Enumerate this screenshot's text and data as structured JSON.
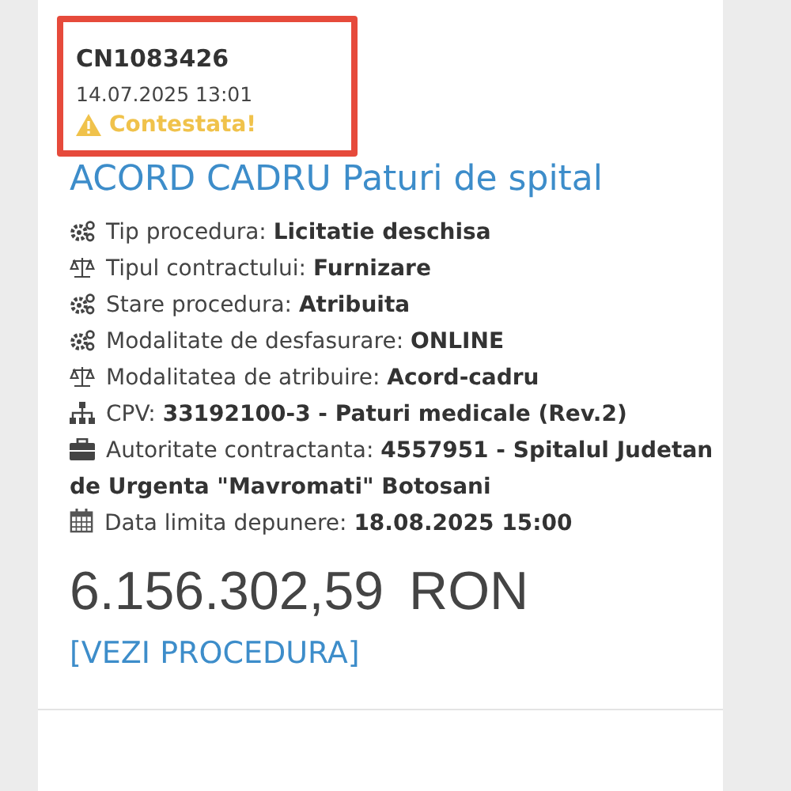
{
  "header": {
    "code": "CN1083426",
    "date": "14.07.2025 13:01",
    "status": {
      "kind": "warning",
      "text": "Contestata!"
    },
    "highlighted": true
  },
  "title": "ACORD CADRU Paturi de spital",
  "details": [
    {
      "kind": "gears",
      "text": "Tip procedura: **Licitatie deschisa**"
    },
    {
      "kind": "scale",
      "text": "Tipul contractului: **Furnizare**"
    },
    {
      "kind": "gears",
      "text": "Stare procedura: **Atribuita**"
    },
    {
      "kind": "gears",
      "text": "Modalitate de desfasurare: **ONLINE**"
    },
    {
      "kind": "scale",
      "text": "Modalitatea de atribuire: **Acord-cadru**"
    },
    {
      "kind": "sitemap",
      "text": "CPV: **33192100-3 - Paturi medicale (Rev.2)**"
    },
    {
      "kind": "briefcase",
      "text": "Autoritate contractanta: **4557951 - Spitalul Judetan**",
      "continuation": "de Urgenta \"Mavromati\" Botosani"
    },
    {
      "kind": "calendar",
      "text": "Data limita depunere: **18.08.2025 15:00**"
    }
  ],
  "amount": "6.156.302,59",
  "currency": "RON",
  "link": "[VEZI PROCEDURA]"
}
